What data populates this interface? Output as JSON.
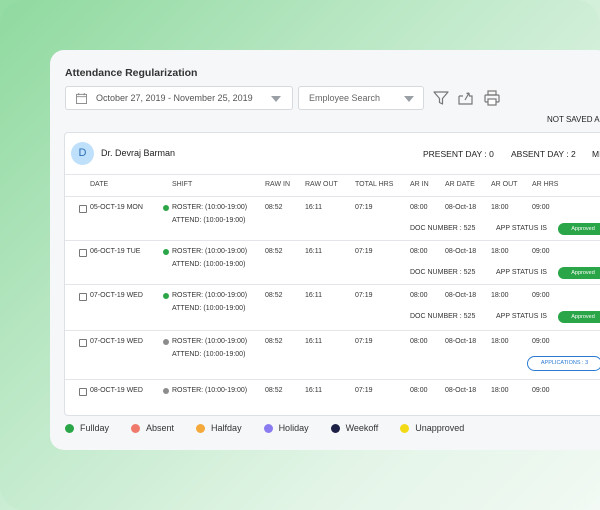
{
  "title": "Attendance Regularization",
  "date_range": "October 27, 2019 - November 25, 2019",
  "employee_search_placeholder": "Employee Search",
  "not_saved": "NOT SAVED AP",
  "employee": {
    "initial": "D",
    "name": "Dr. Devraj Barman",
    "present": "PRESENT DAY : 0",
    "absent": "ABSENT DAY : 2",
    "more": "MI"
  },
  "columns": [
    "DATE",
    "SHIFT",
    "RAW IN",
    "RAW OUT",
    "TOTAL HRS",
    "AR IN",
    "AR DATE",
    "AR OUT",
    "AR HRS"
  ],
  "rows": [
    {
      "date": "05-OCT-19 MON",
      "dot_color": "#2aa547",
      "roster": "ROSTER: (10:00-19:00)",
      "attend": "ATTEND: (10:00-19:00)",
      "raw_in": "08:52",
      "raw_out": "16:11",
      "total": "07:19",
      "ar_in": "08:00",
      "ar_date": "08-Oct-18",
      "ar_out": "18:00",
      "ar_hrs": "09:00",
      "doc": "DOC NUMBER : 525",
      "app_status": "APP STATUS IS",
      "badge": "Approved"
    },
    {
      "date": "06-OCT-19 TUE",
      "dot_color": "#2aa547",
      "roster": "ROSTER: (10:00-19:00)",
      "attend": "ATTEND: (10:00-19:00)",
      "raw_in": "08:52",
      "raw_out": "16:11",
      "total": "07:19",
      "ar_in": "08:00",
      "ar_date": "08-Oct-18",
      "ar_out": "18:00",
      "ar_hrs": "09:00",
      "doc": "DOC NUMBER : 525",
      "app_status": "APP STATUS IS",
      "badge": "Approved"
    },
    {
      "date": "07-OCT-19 WED",
      "dot_color": "#2aa547",
      "roster": "ROSTER: (10:00-19:00)",
      "attend": "ATTEND: (10:00-19:00)",
      "raw_in": "08:52",
      "raw_out": "16:11",
      "total": "07:19",
      "ar_in": "08:00",
      "ar_date": "08-Oct-18",
      "ar_out": "18:00",
      "ar_hrs": "09:00",
      "doc": "DOC NUMBER : 525",
      "app_status": "APP STATUS IS",
      "badge": "Approved"
    },
    {
      "date": "07-OCT-19 WED",
      "dot_color": "#8c8c8c",
      "roster": "ROSTER: (10:00-19:00)",
      "attend": "ATTEND: (10:00-19:00)",
      "raw_in": "08:52",
      "raw_out": "16:11",
      "total": "07:19",
      "ar_in": "08:00",
      "ar_date": "08-Oct-18",
      "ar_out": "18:00",
      "ar_hrs": "09:00",
      "applications": "APPLICATIONS : 3"
    },
    {
      "date": "08-OCT-19 WED",
      "dot_color": "#8c8c8c",
      "roster": "ROSTER: (10:00-19:00)",
      "raw_in": "08:52",
      "raw_out": "16:11",
      "total": "07:19",
      "ar_in": "08:00",
      "ar_date": "08-Oct-18",
      "ar_out": "18:00",
      "ar_hrs": "09:00"
    }
  ],
  "legend": [
    {
      "label": "Fullday",
      "color": "#2aa547"
    },
    {
      "label": "Absent",
      "color": "#ef7a6b"
    },
    {
      "label": "Halfday",
      "color": "#f4a93a"
    },
    {
      "label": "Holiday",
      "color": "#8a7cf0"
    },
    {
      "label": "Weekoff",
      "color": "#1d2146"
    },
    {
      "label": "Unapproved",
      "color": "#f2da17"
    }
  ]
}
